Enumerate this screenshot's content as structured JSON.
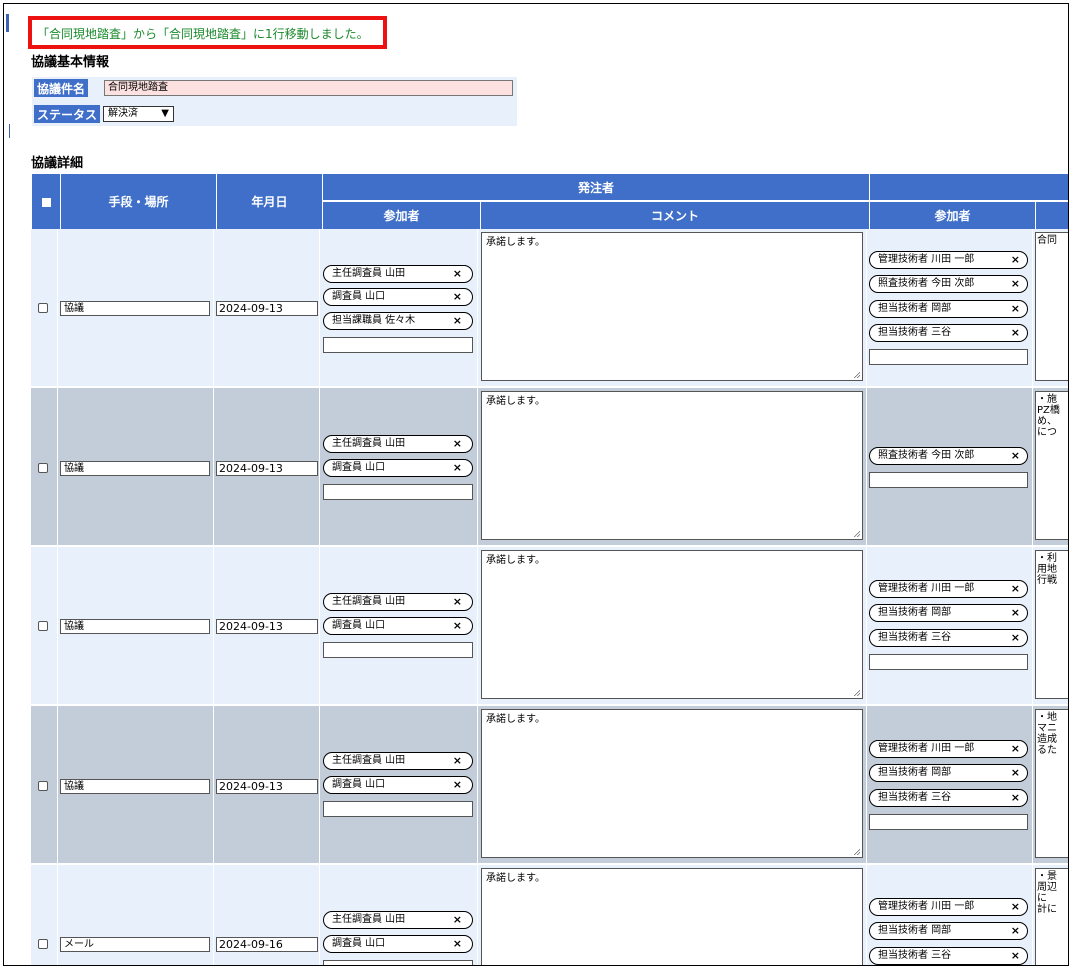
{
  "flash_message": "「合同現地踏査」から「合同現地踏査」に1行移動しました。",
  "basic": {
    "title": "協議基本情報",
    "name_label": "協議件名",
    "name_value": "合同現地踏査",
    "status_label": "ステータス",
    "status_value": "解決済"
  },
  "detail": {
    "title": "協議詳細",
    "headers": {
      "mode": "手段・場所",
      "date": "年月日",
      "orderer": "発注者",
      "participants": "参加者",
      "comment": "コメント",
      "participants2": "参加者"
    }
  },
  "rows": [
    {
      "mode": "協議",
      "date": "2024-09-13",
      "participants": [
        "主任調査員 山田",
        "調査員 山口",
        "担当課職員 佐々木"
      ],
      "comment": "承諾します。",
      "other_participants": [
        "管理技術者 川田 一郎",
        "照査技術者 今田 次郎",
        "担当技術者 岡部",
        "担当技術者 三谷"
      ],
      "other_comment": "合同"
    },
    {
      "mode": "協議",
      "date": "2024-09-13",
      "participants": [
        "主任調査員 山田",
        "調査員 山口"
      ],
      "comment": "承諾します。",
      "other_participants": [
        "照査技術者 今田 次郎"
      ],
      "other_comment": "・施\nPZ橋\nめ、\nにつ"
    },
    {
      "mode": "協議",
      "date": "2024-09-13",
      "participants": [
        "主任調査員 山田",
        "調査員 山口"
      ],
      "comment": "承諾します。",
      "other_participants": [
        "管理技術者 川田 一郎",
        "担当技術者 岡部",
        "担当技術者 三谷"
      ],
      "other_comment": "・利\n用地\n行戦"
    },
    {
      "mode": "協議",
      "date": "2024-09-13",
      "participants": [
        "主任調査員 山田",
        "調査員 山口"
      ],
      "comment": "承諾します。",
      "other_participants": [
        "管理技術者 川田 一郎",
        "担当技術者 岡部",
        "担当技術者 三谷"
      ],
      "other_comment": "・地\nマニ\n造成\nるた"
    },
    {
      "mode": "メール",
      "date": "2024-09-16",
      "participants": [
        "主任調査員 山田",
        "調査員 山口"
      ],
      "comment": "承諾します。",
      "other_participants": [
        "管理技術者 川田 一郎",
        "担当技術者 岡部",
        "担当技術者 三谷"
      ],
      "other_comment": "・景\n周辺\nに\n計に"
    }
  ]
}
